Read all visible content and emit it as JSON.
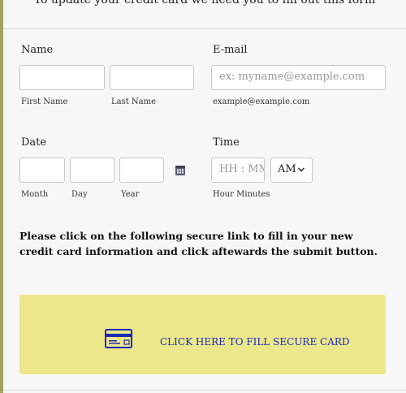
{
  "header": {
    "text": "To update your credit card we need you to fill out this form"
  },
  "name": {
    "label": "Name",
    "first_sublabel": "First Name",
    "last_sublabel": "Last Name"
  },
  "email": {
    "label": "E-mail",
    "placeholder": "ex: myname@example.com",
    "sublabel": "example@example.com"
  },
  "date": {
    "label": "Date",
    "month_sublabel": "Month",
    "day_sublabel": "Day",
    "year_sublabel": "Year",
    "calendar_icon": "calendar-icon"
  },
  "time": {
    "label": "Time",
    "placeholder": "HH : MM",
    "ampm_value": "AM",
    "sublabel": "Hour Minutes"
  },
  "instructions": {
    "text": "Please click on the following secure link to fill in your new credit card information and click aftewards the submit button."
  },
  "secure_link": {
    "label": "CLICK HERE TO FILL SECURE CARD",
    "icon": "credit-card-icon",
    "background_color": "#ede78b",
    "link_color": "#1a2ab8"
  }
}
